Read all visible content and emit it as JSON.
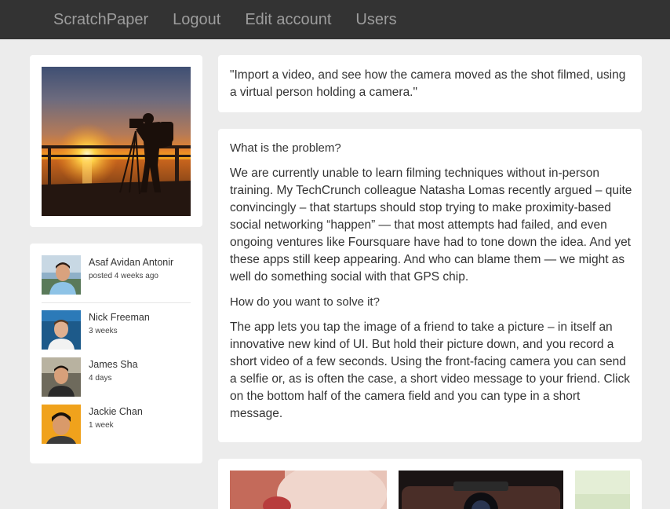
{
  "nav": {
    "brand": "ScratchPaper",
    "logout": "Logout",
    "edit_account": "Edit account",
    "users": "Users"
  },
  "quote": "\"Import a video, and see how the camera moved as the shot filmed, using a virtual person holding a camera.\"",
  "problem": {
    "heading": "What is the problem?",
    "body": "We are currently unable to learn filming techniques without in-person training. My TechCrunch colleague Natasha Lomas recently argued – quite convincingly – that startups should stop trying to make proximity-based social networking “happen” — that most attempts had failed, and even ongoing ventures like Foursquare have had to tone down the idea. And yet these apps still keep appearing. And who can blame them — we might as well do something social with that GPS chip."
  },
  "solution": {
    "heading": "How do you want to solve it?",
    "body": "The app lets you tap the image of a friend to take a picture – in itself an innovative new kind of UI. But hold their picture down, and you record a short video of a few seconds. Using the front-facing camera you can send a selfie or, as is often the case, a short video message to your friend. Click on the bottom half of the camera field and you can type in a short message."
  },
  "users": [
    {
      "name": "Asaf Avidan Antonir",
      "time": "posted 4 weeks ago"
    },
    {
      "name": "Nick Freeman",
      "time": "3 weeks"
    },
    {
      "name": "James Sha",
      "time": "4 days"
    },
    {
      "name": "Jackie Chan",
      "time": "1 week"
    }
  ],
  "colors": {
    "navbar": "#333333",
    "nav_text": "#9d9d9d",
    "background": "#ececec",
    "card": "#ffffff"
  }
}
